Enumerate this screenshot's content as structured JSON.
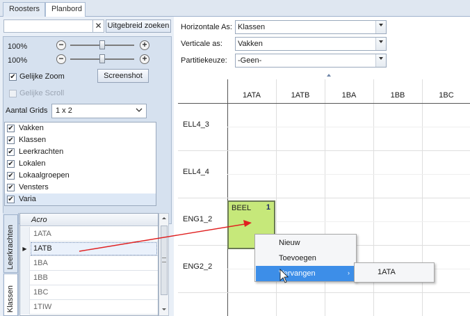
{
  "tabs": [
    {
      "label": "Roosters"
    },
    {
      "label": "Planbord"
    }
  ],
  "search": {
    "value": "",
    "clear_glyph": "✕",
    "advanced_label": "Uitgebreid zoeken"
  },
  "zoom": {
    "h_pct": "100%",
    "v_pct": "100%",
    "h_level": 0.5,
    "v_level": 0.5,
    "minus": "−",
    "plus": "+"
  },
  "options": {
    "equal_zoom_label": "Gelijke Zoom",
    "equal_zoom_checked": true,
    "equal_scroll_label": "Gelijke Scroll",
    "equal_scroll_checked": false,
    "screenshot_label": "Screenshot",
    "grids_label": "Aantal Grids",
    "grids_value": "1 x 2"
  },
  "layers": [
    {
      "label": "Vakken",
      "checked": true
    },
    {
      "label": "Klassen",
      "checked": true
    },
    {
      "label": "Leerkrachten",
      "checked": true
    },
    {
      "label": "Lokalen",
      "checked": true
    },
    {
      "label": "Lokaalgroepen",
      "checked": true
    },
    {
      "label": "Vensters",
      "checked": true
    },
    {
      "label": "Varia",
      "checked": true
    }
  ],
  "side_tabs": [
    {
      "label": "Leerkrachten"
    },
    {
      "label": "Klassen"
    }
  ],
  "acro_list": {
    "header": "Acro",
    "rows": [
      "1ATA",
      "1ATB",
      "1BA",
      "1BB",
      "1BC",
      "1TIW"
    ],
    "current_marker": "▶"
  },
  "axes": {
    "horizontal_label": "Horizontale As:",
    "horizontal_value": "Klassen",
    "vertical_label": "Verticale as:",
    "vertical_value": "Vakken",
    "partition_label": "Partitiekeuze:",
    "partition_value": "-Geen-"
  },
  "grid": {
    "columns": [
      "1ATA",
      "1ATB",
      "1BA",
      "1BB",
      "1BC"
    ],
    "rows": [
      "ELL4_3",
      "ELL4_4",
      "ENG1_2",
      "ENG2_2"
    ]
  },
  "lesson_card": {
    "subject": "BEEL",
    "count": "1",
    "color": "#c6e87a"
  },
  "context_menu": {
    "items": [
      "Nieuw",
      "Toevoegen",
      "Vervangen"
    ],
    "submenu_arrow": "›",
    "submenu_items": [
      "1ATA"
    ],
    "highlight_color": "#3d8ee8"
  },
  "colors": {
    "accent": "#3d8ee8",
    "arrow": "#e02020",
    "panel": "#d6e1ef"
  }
}
